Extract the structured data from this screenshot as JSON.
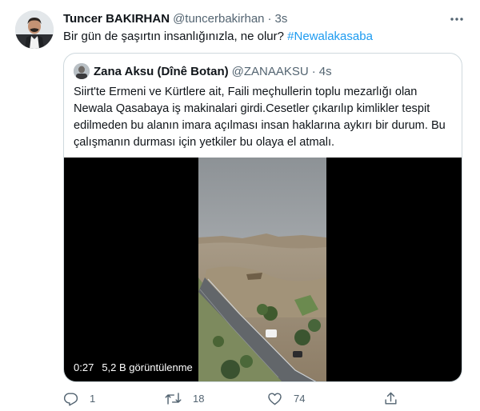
{
  "tweet": {
    "author_name": "Tuncer BAKIRHAN",
    "author_handle": "@tuncerbakirhan",
    "separator": "·",
    "time": "3s",
    "text": "Bir gün de şaşırtın insanlığınızla, ne olur?",
    "hashtag": "#Newalakasaba"
  },
  "quote": {
    "author_name": "Zana Aksu (Dînê Botan)",
    "author_handle": "@ZANAAKSU",
    "separator": "·",
    "time": "4s",
    "text_lines": [
      "Siirt'te Ermeni ve Kürtlere ait, Faili meçhullerin toplu mezarlığı olan",
      "Newala Qasabaya iş makinalari girdi.Cesetler çıkarılıp kimlikler tespit",
      "edilmeden bu alanın imara açılması insan haklarına aykırı bir durum. Bu",
      "çalışmanın durması için yetkiler bu olaya el atmalı."
    ],
    "video": {
      "duration": "0:27",
      "views": "5,2 B görüntülenme"
    }
  },
  "actions": {
    "reply": {
      "icon": "reply-icon",
      "count": "1"
    },
    "retweet": {
      "icon": "retweet-icon",
      "count": "18"
    },
    "like": {
      "icon": "heart-icon",
      "count": "74"
    },
    "share": {
      "icon": "share-icon",
      "count": ""
    }
  },
  "colors": {
    "text": "#0f1419",
    "secondary": "#536471",
    "link": "#1d9bf0",
    "border": "#cfd9de",
    "video_bg": "#000000"
  }
}
